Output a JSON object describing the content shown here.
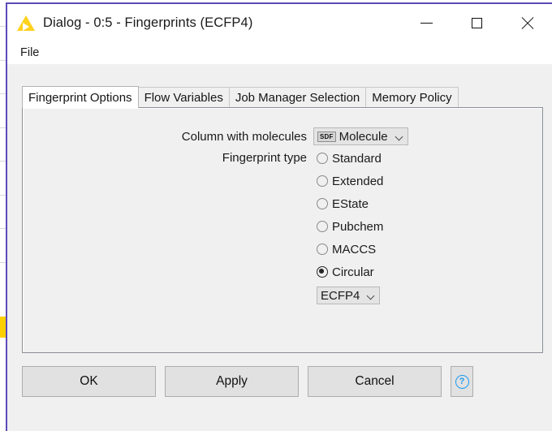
{
  "background_app": {
    "node_marker_color": "#ffd000",
    "frame_color": "#5b4bb7"
  },
  "window": {
    "icon": "knime-triangle-icon",
    "title": "Dialog - 0:5 - Fingerprints (ECFP4)",
    "controls": {
      "minimize": "minimize-icon",
      "maximize": "maximize-icon",
      "close": "close-icon"
    }
  },
  "menu": {
    "items": [
      {
        "label": "File"
      }
    ]
  },
  "tabs": [
    {
      "label": "Fingerprint Options",
      "active": true
    },
    {
      "label": "Flow Variables",
      "active": false
    },
    {
      "label": "Job Manager Selection",
      "active": false
    },
    {
      "label": "Memory Policy",
      "active": false
    }
  ],
  "form": {
    "column_label": "Column with molecules",
    "column_value": "Molecule",
    "column_type_badge": "SDF",
    "fingerprint_label": "Fingerprint type",
    "fingerprint_options": [
      {
        "label": "Standard",
        "selected": false
      },
      {
        "label": "Extended",
        "selected": false
      },
      {
        "label": "EState",
        "selected": false
      },
      {
        "label": "Pubchem",
        "selected": false
      },
      {
        "label": "MACCS",
        "selected": false
      },
      {
        "label": "Circular",
        "selected": true
      }
    ],
    "circular_variant_value": "ECFP4"
  },
  "buttons": {
    "ok": "OK",
    "apply": "Apply",
    "cancel": "Cancel",
    "help": "?"
  }
}
